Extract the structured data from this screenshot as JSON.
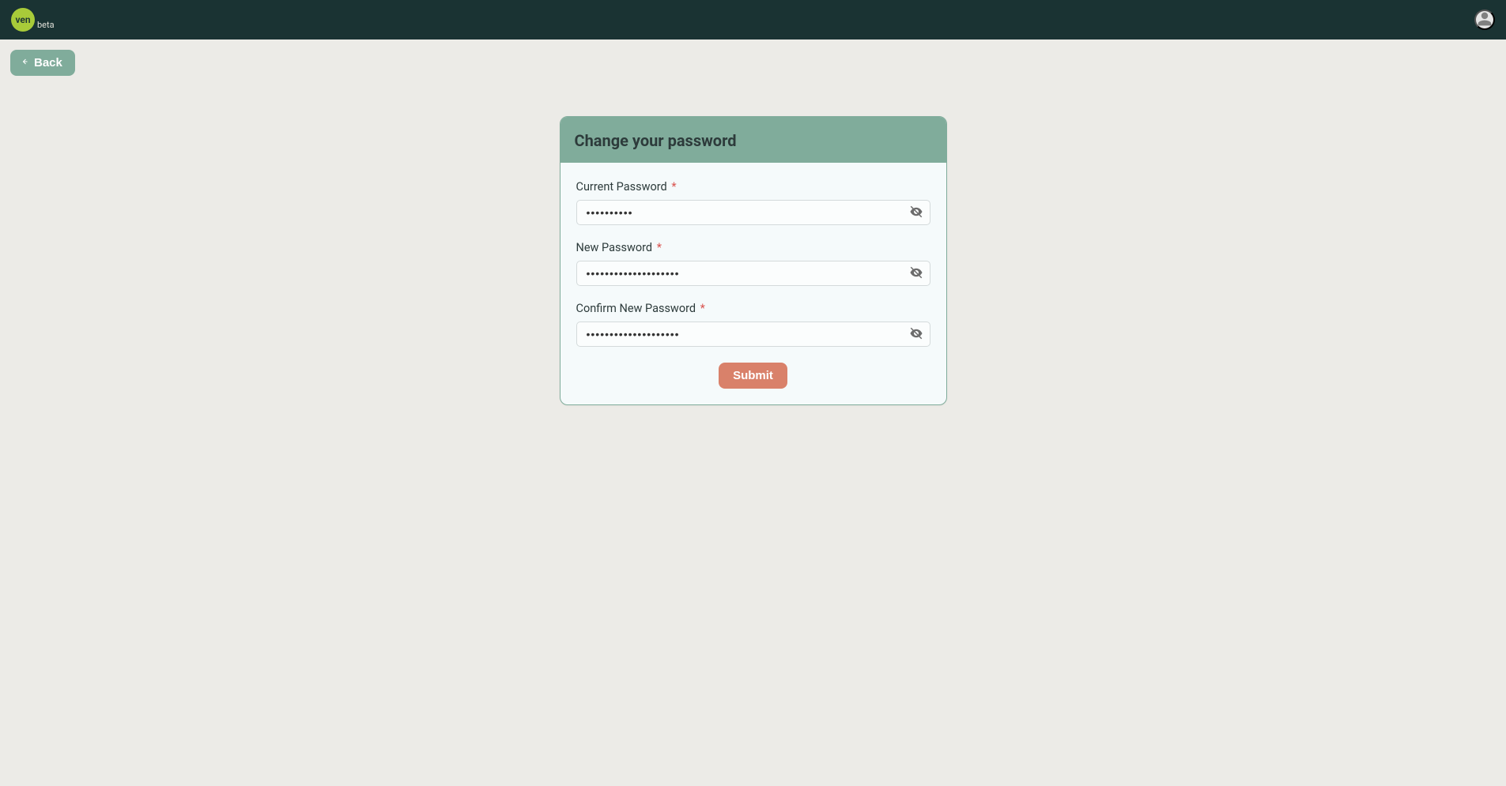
{
  "header": {
    "logo_text": "ven",
    "logo_sub": "beta"
  },
  "nav": {
    "back_label": "Back"
  },
  "card": {
    "title": "Change your password",
    "required_marker": "*",
    "fields": {
      "current": {
        "label": "Current Password",
        "value": "••••••••••"
      },
      "new": {
        "label": "New Password",
        "value": "••••••••••••••••••••"
      },
      "confirm": {
        "label": "Confirm New Password",
        "value": "••••••••••••••••••••"
      }
    },
    "submit_label": "Submit"
  },
  "colors": {
    "header_bg": "#1a3333",
    "page_bg": "#ecebe7",
    "accent_green": "#80ac9b",
    "accent_orange": "#d9816a",
    "logo_green": "#a8cb39"
  }
}
